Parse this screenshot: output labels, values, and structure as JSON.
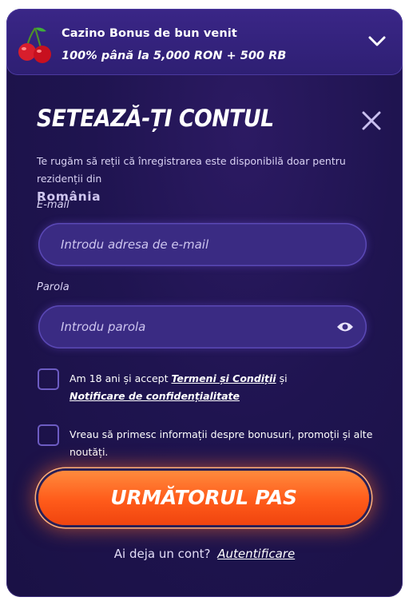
{
  "bonus": {
    "title": "Cazino Bonus de bun venit",
    "offer": "100% până la 5,000 RON + 500 RB",
    "icon": "cherry-icon",
    "toggle_icon": "chevron-down-icon"
  },
  "form": {
    "heading": "SETEAZĂ-ȚI CONTUL",
    "close_icon": "close-icon",
    "notice": "Te rugăm să reții că înregistrarea este disponibilă doar pentru rezidenții din",
    "notice_country": "România",
    "email": {
      "label": "E-mail",
      "placeholder": "Introdu adresa de e-mail"
    },
    "password": {
      "label": "Parola",
      "placeholder": "Introdu parola",
      "toggle_icon": "eye-icon"
    },
    "terms": {
      "text_before": "Am 18 ani și accept",
      "terms_link": "Termeni și Condiții",
      "text_and": "și",
      "privacy_link": "Notificare de confidențialitate",
      "checked": false
    },
    "marketing": {
      "text": "Vreau să primesc informații despre bonusuri, promoții și alte noutăți.",
      "checked": false
    },
    "submit_label": "URMĂTORUL PAS",
    "signin_prompt": "Ai deja un cont?",
    "signin_link": "Autentificare"
  },
  "colors": {
    "background": "#1f1450",
    "accent": "#ff5b1a",
    "input_bg": "#3a2b83"
  }
}
